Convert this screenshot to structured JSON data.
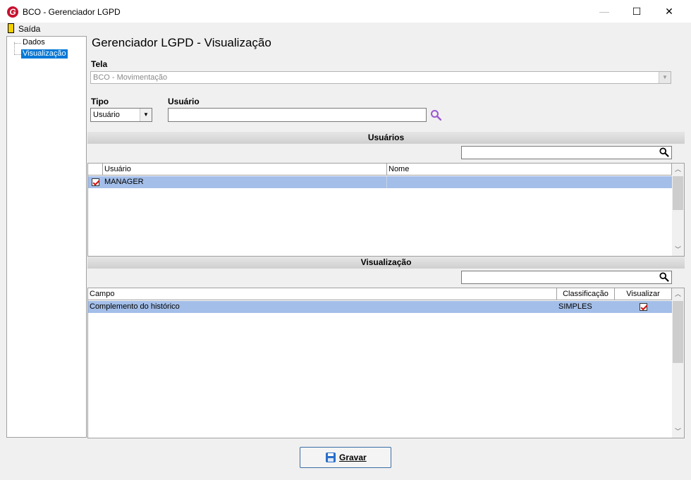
{
  "window": {
    "title": "BCO - Gerenciador LGPD",
    "logo_letter": "G",
    "minimize_glyph": "—",
    "maximize_glyph": "☐",
    "close_glyph": "✕"
  },
  "menu": {
    "exit_label": "Saída"
  },
  "tree": {
    "items": [
      "Dados",
      "Visualização"
    ],
    "selected": "Visualização"
  },
  "page": {
    "title": "Gerenciador LGPD - Visualização"
  },
  "tela": {
    "label": "Tela",
    "value": "BCO - Movimentação"
  },
  "tipo": {
    "label": "Tipo",
    "value": "Usuário"
  },
  "usuario": {
    "label": "Usuário",
    "value": ""
  },
  "users_section": {
    "title": "Usuários",
    "search_value": "",
    "columns": [
      "Usuário",
      "Nome"
    ],
    "rows": [
      {
        "checked": true,
        "usuario": "MANAGER",
        "nome": ""
      }
    ]
  },
  "view_section": {
    "title": "Visualização",
    "search_value": "",
    "columns": [
      "Campo",
      "Classificação",
      "Visualizar"
    ],
    "rows": [
      {
        "campo": "Complemento do histórico",
        "classificacao": "SIMPLES",
        "visualizar": true
      }
    ]
  },
  "footer": {
    "save_label": "Gravar"
  },
  "colors": {
    "selection_row": "#a3bee8",
    "tree_selection": "#0078d7",
    "logo": "#c8102e",
    "accent_border": "#3b6ea5"
  },
  "icons": [
    "app-logo",
    "exit-icon",
    "magnifier-icon",
    "floppy-save-icon",
    "checkbox-checked-icon"
  ]
}
